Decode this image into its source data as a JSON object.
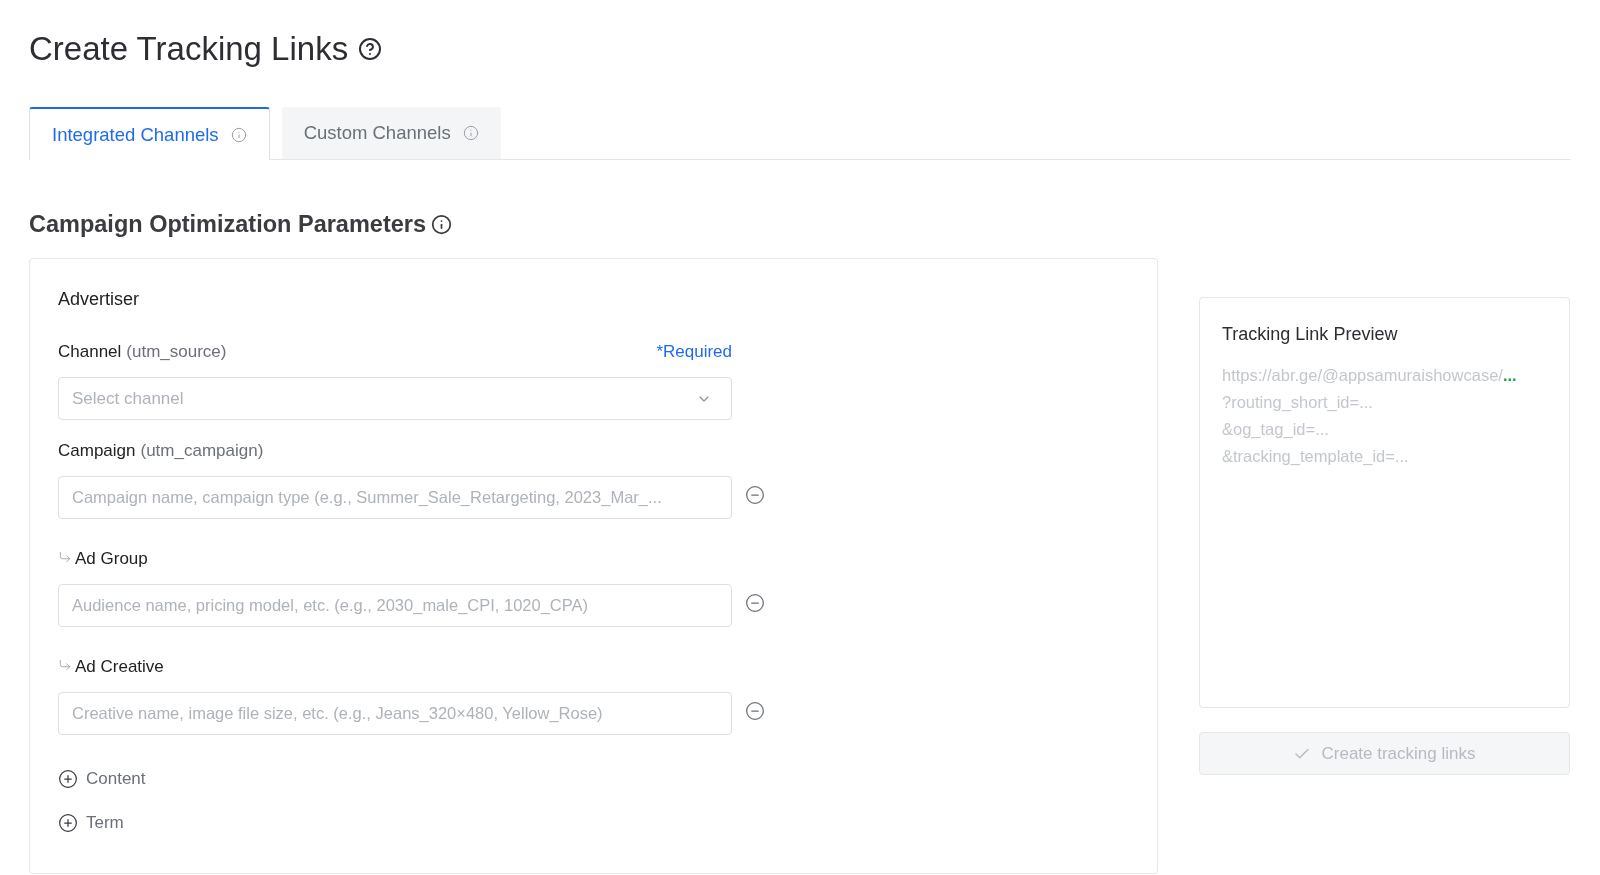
{
  "page": {
    "title": "Create Tracking Links"
  },
  "tabs": [
    {
      "label": "Integrated Channels",
      "selected": true
    },
    {
      "label": "Custom Channels",
      "selected": false
    }
  ],
  "section": {
    "title": "Campaign Optimization Parameters"
  },
  "form": {
    "heading": "Advertiser",
    "fields": [
      {
        "kind": "select",
        "label": "Channel",
        "hint": "(utm_source)",
        "required_note": "*Required",
        "placeholder": "Select channel",
        "removable": false
      },
      {
        "kind": "text",
        "label": "Campaign",
        "hint": "(utm_campaign)",
        "placeholder": "Campaign name, campaign type (e.g., Summer_Sale_Retargeting, 2023_Mar_...",
        "removable": true,
        "children": [
          {
            "kind": "text",
            "label": "Ad Group",
            "placeholder": "Audience name, pricing model, etc. (e.g., 2030_male_CPI, 1020_CPA)",
            "removable": true,
            "children": [
              {
                "kind": "text",
                "label": "Ad Creative",
                "placeholder": "Creative name, image file size, etc. (e.g., Jeans_320×480, Yellow_Rose)",
                "removable": true
              }
            ]
          }
        ]
      }
    ],
    "optional_fields": [
      {
        "label": "Content"
      },
      {
        "label": "Term"
      }
    ]
  },
  "preview": {
    "title": "Tracking Link Preview",
    "lines": [
      {
        "text": "https://abr.ge/@appsamuraishowcase/",
        "more": "..."
      },
      {
        "text": "?routing_short_id=..."
      },
      {
        "text": "&og_tag_id=..."
      },
      {
        "text": "&tracking_template_id=..."
      }
    ]
  },
  "create_button": {
    "label": "Create tracking links",
    "disabled": true
  }
}
